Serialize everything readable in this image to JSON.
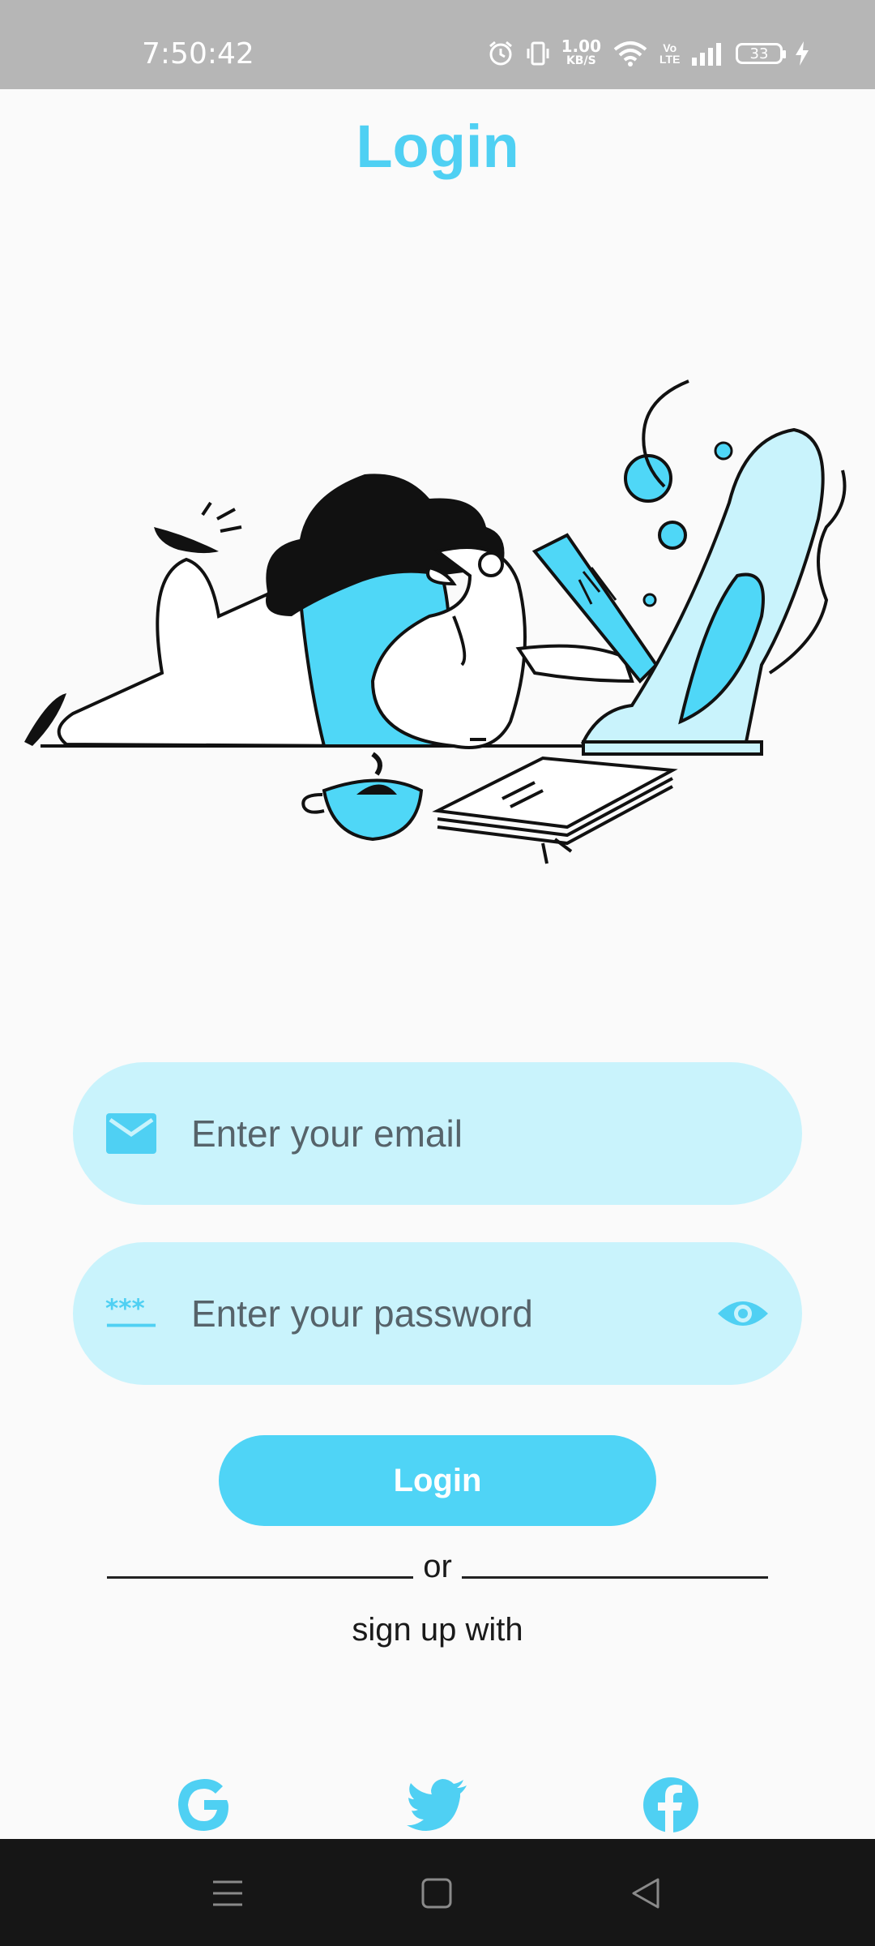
{
  "status_bar": {
    "time": "7:50:42",
    "net_speed_value": "1.00",
    "net_speed_unit": "KB/S",
    "volte": "Vo LTE",
    "battery": "33",
    "icons": [
      "alarm-icon",
      "vibrate-icon",
      "wifi-icon",
      "signal-icon",
      "battery-icon",
      "charging-icon"
    ]
  },
  "header": {
    "title": "Login"
  },
  "form": {
    "email_placeholder": "Enter your email",
    "email_value": "",
    "password_placeholder": "Enter your password",
    "password_value": "",
    "password_prefix_icon": "***",
    "login_label": "Login"
  },
  "divider": {
    "text": "or"
  },
  "signup": {
    "text": "sign up with",
    "providers": [
      "google",
      "twitter",
      "facebook"
    ]
  },
  "colors": {
    "accent": "#4fd0f3",
    "field_bg": "#c9f3fc",
    "button_bg": "#4fd4f6",
    "status_bar": "#b6b6b6",
    "nav_bar": "#161616"
  }
}
